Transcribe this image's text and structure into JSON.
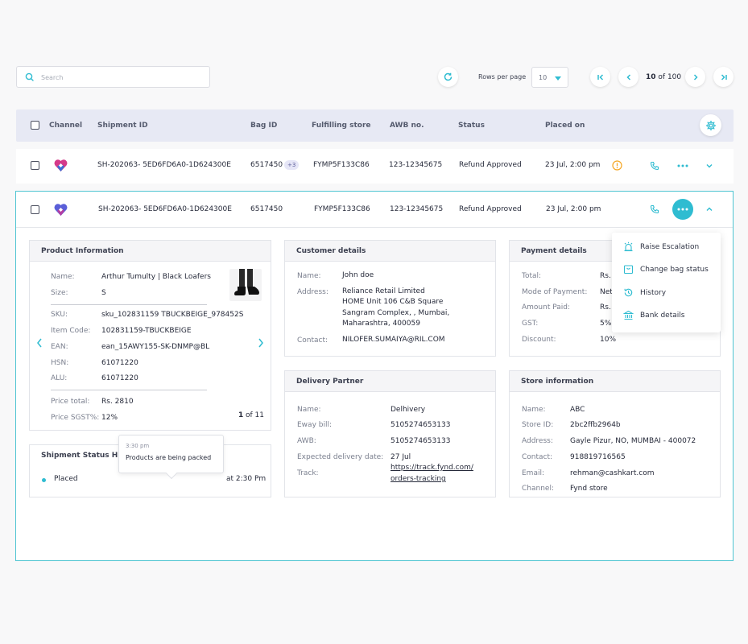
{
  "search": {
    "placeholder": "Search"
  },
  "pagination": {
    "rows_label": "Rows per page",
    "rows_value": "10",
    "current": "10",
    "of_label": "of 100"
  },
  "table": {
    "headers": [
      "Channel",
      "Shipment ID",
      "Bag ID",
      "Fulfilling store",
      "AWB no.",
      "Status",
      "Placed on"
    ]
  },
  "row1": {
    "shipment_id": "SH-202063- 5ED6FD6A0-1D624300E",
    "bag_id": "6517450",
    "bag_extra": "+3",
    "store": "FYMP5F133C86",
    "awb": "123-12345675",
    "status": "Refund Approved",
    "placed_on": "23 Jul, 2:00 pm"
  },
  "row2": {
    "shipment_id": "SH-202063- 5ED6FD6A0-1D624300E",
    "bag_id": "6517450",
    "store": "FYMP5F133C86",
    "awb": "123-12345675",
    "status": "Refund Approved",
    "placed_on": "23 Jul, 2:00 pm"
  },
  "product": {
    "title": "Product Information",
    "name_label": "Name:",
    "name": "Arthur Tumulty | Black Loafers",
    "size_label": "Size:",
    "size": "S",
    "sku_label": "SKU:",
    "sku": "sku_102831159 TBUCKBEIGE_978452S",
    "item_label": "Item Code:",
    "item": "102831159-TBUCKBEIGE",
    "ean_label": "EAN:",
    "ean": "ean_15AWY155-SK-DNMP@BL",
    "hsn_label": "HSN:",
    "hsn": "61071220",
    "alu_label": "ALU:",
    "alu": "61071220",
    "price_label": "Price total:",
    "price": "Rs. 2810",
    "sgst_label": "Price SGST%:",
    "sgst": "12%",
    "page_current": "1",
    "page_total": "of 11"
  },
  "customer": {
    "title": "Customer details",
    "name_label": "Name:",
    "name": "John doe",
    "address_label": "Address:",
    "address_lines": [
      "Reliance Retail Limited",
      "HOME Unit 106 C&B Square",
      "Sangram Complex, , Mumbai,",
      "Maharashtra, 400059"
    ],
    "contact_label": "Contact:",
    "contact": "NILOFER.SUMAIYA@RIL.COM"
  },
  "payment": {
    "title": "Payment details",
    "total_label": "Total:",
    "total": "Rs.",
    "mode_label": "Mode of Payment:",
    "mode": "Net",
    "paid_label": "Amount Paid:",
    "paid": "Rs.",
    "gst_label": "GST:",
    "gst": "5%",
    "discount_label": "Discount:",
    "discount": "10%"
  },
  "menu": {
    "items": [
      "Raise Escalation",
      "Change bag status",
      "History",
      "Bank details"
    ]
  },
  "delivery": {
    "title": "Delivery Partner",
    "name_label": "Name:",
    "name": "Delhivery",
    "eway_label": "Eway bill:",
    "eway": "5105274653133",
    "awb_label": "AWB:",
    "awb": "5105274653133",
    "date_label": "Expected delivery date:",
    "date": "27 Jul",
    "track_label": "Track:",
    "track_1": "https://track.fynd.com/",
    "track_2": "orders-tracking"
  },
  "store": {
    "title": "Store information",
    "name_label": "Name:",
    "name": "ABC",
    "id_label": "Store ID:",
    "id": "2bc2ffb2964b",
    "address_label": "Address:",
    "address": "Gayle Pizur, NO, MUMBAI - 400072",
    "contact_label": "Contact:",
    "contact": "918819716565",
    "email_label": "Email:",
    "email": "rehman@cashkart.com",
    "channel_label": "Channel:",
    "channel": "Fynd store"
  },
  "status_history": {
    "title": "Shipment Status His",
    "entry_label": "Placed",
    "entry_time": "at 2:30 Pm",
    "tooltip_time": "3:30 pm",
    "tooltip_text": "Products are being packed"
  },
  "colors": {
    "accent": "#2fbcd1",
    "header_bg": "#e7e9f4",
    "warning": "#f5a623"
  }
}
